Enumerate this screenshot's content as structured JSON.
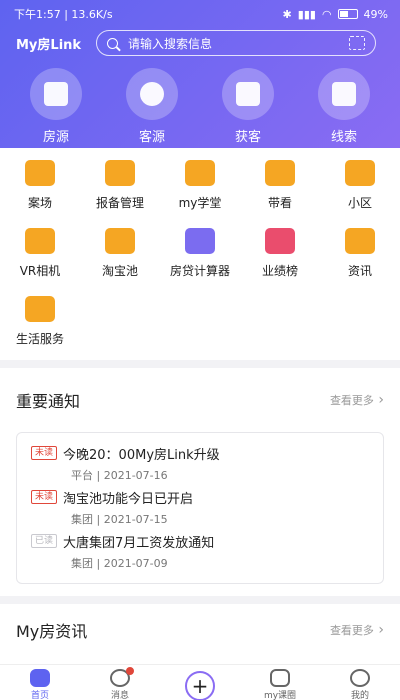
{
  "status": {
    "time": "下午1:57",
    "speed": "13.6K/s",
    "battery": "49%"
  },
  "header": {
    "brand": "My房Link",
    "search_placeholder": "请输入搜索信息"
  },
  "quick_nav": [
    {
      "label": "房源",
      "icon": "building-icon"
    },
    {
      "label": "客源",
      "icon": "person-icon"
    },
    {
      "label": "获客",
      "icon": "clipboard-icon"
    },
    {
      "label": "线索",
      "icon": "newspaper-icon"
    }
  ],
  "grid": [
    {
      "label": "案场",
      "icon": "layers-icon",
      "color": "#f5a623"
    },
    {
      "label": "报备管理",
      "icon": "briefcase-icon",
      "color": "#f5a623"
    },
    {
      "label": "my学堂",
      "icon": "graduation-cap-icon",
      "color": "#f5a623"
    },
    {
      "label": "带看",
      "icon": "eye-icon",
      "color": "#f5a623"
    },
    {
      "label": "小区",
      "icon": "community-icon",
      "color": "#f5a623"
    },
    {
      "label": "VR相机",
      "icon": "camera-icon",
      "color": "#f5a623"
    },
    {
      "label": "淘宝池",
      "icon": "pool-icon",
      "color": "#f5a623"
    },
    {
      "label": "房贷计算器",
      "icon": "calculator-icon",
      "color": "#7b6cf0"
    },
    {
      "label": "业绩榜",
      "icon": "podium-icon",
      "color": "#ea4d6d"
    },
    {
      "label": "资讯",
      "icon": "document-icon",
      "color": "#f5a623"
    },
    {
      "label": "生活服务",
      "icon": "home-heart-icon",
      "color": "#f5a623"
    }
  ],
  "notice": {
    "title": "重要通知",
    "more": "查看更多",
    "items": [
      {
        "tag": "未读",
        "title": "今晚20：00My房Link升级",
        "meta": "平台 | 2021-07-16"
      },
      {
        "tag": "未读",
        "title": "淘宝池功能今日已开启",
        "meta": "集团 | 2021-07-15"
      },
      {
        "tag": "已读",
        "title": "大唐集团7月工资发放通知",
        "meta": "集团 | 2021-07-09"
      }
    ]
  },
  "news": {
    "title": "My房资讯",
    "more": "查看更多"
  },
  "tabbar": [
    {
      "label": "首页",
      "active": true
    },
    {
      "label": "消息",
      "active": false
    },
    {
      "label": "",
      "active": false
    },
    {
      "label": "my课圈",
      "active": false
    },
    {
      "label": "我的",
      "active": false
    }
  ],
  "colors": {
    "accent": "#5e63f0",
    "accent2": "#8a6cf3",
    "unread": "#e0473a",
    "orange": "#f5a623"
  }
}
